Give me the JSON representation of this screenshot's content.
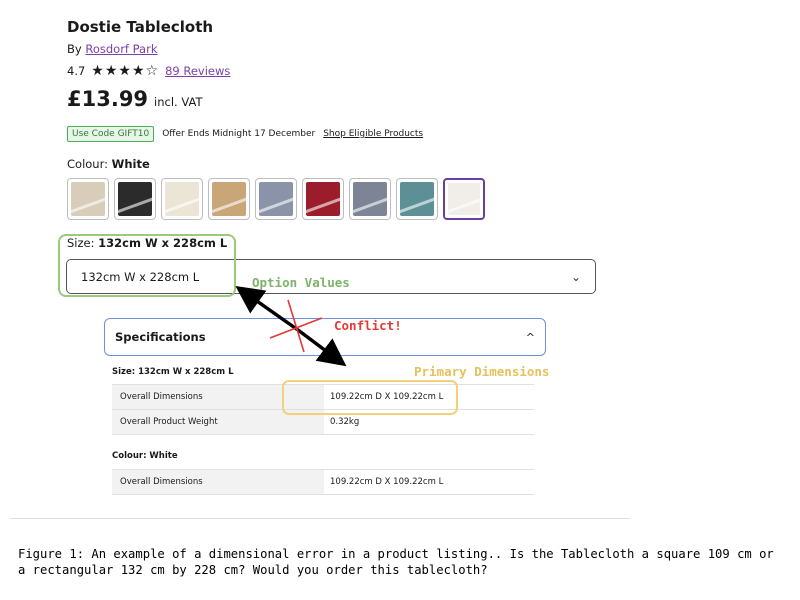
{
  "product": {
    "title": "Dostie Tablecloth",
    "by_prefix": "By",
    "brand": "Rosdorf Park",
    "rating": "4.7",
    "stars": "★★★★☆",
    "reviews": "89 Reviews",
    "price": "£13.99",
    "vat": "incl. VAT"
  },
  "promo": {
    "code": "Use Code GIFT10",
    "offer": "Offer Ends Midnight 17 December",
    "link": "Shop Eligible Products"
  },
  "colour": {
    "label": "Colour:",
    "value": "White",
    "swatches": [
      {
        "color": "#d8cdb8"
      },
      {
        "color": "#2b2b2b"
      },
      {
        "color": "#ebe5d5"
      },
      {
        "color": "#c9a678"
      },
      {
        "color": "#8a93a8"
      },
      {
        "color": "#9b1c2b"
      },
      {
        "color": "#7c8496"
      },
      {
        "color": "#5d8f97"
      },
      {
        "color": "#f1eeea"
      }
    ]
  },
  "size": {
    "label": "Size:",
    "value": "132cm W x 228cm L",
    "select_value": "132cm W x 228cm L"
  },
  "specs": {
    "title": "Specifications",
    "size_heading": "Size: 132cm W x 228cm L",
    "rows1": [
      {
        "k": "Overall Dimensions",
        "v": "109.22cm D X 109.22cm L"
      },
      {
        "k": "Overall Product Weight",
        "v": "0.32kg"
      }
    ],
    "colour_heading": "Colour: White",
    "rows2": [
      {
        "k": "Overall Dimensions",
        "v": "109.22cm D X 109.22cm L"
      }
    ]
  },
  "annotations": {
    "option_values": "Option Values",
    "primary_dimensions": "Primary Dimensions",
    "conflict": "Conflict!"
  },
  "caption": "Figure 1: An example of a dimensional error in a product listing.. Is the Tablecloth a square 109 cm or a rectangular 132 cm by 228 cm? Would you order this tablecloth?",
  "colors": {
    "accent": "#7b3fa8",
    "option_box": "#9bc97f",
    "primary_box": "#f1d17c",
    "conflict": "#e53935",
    "specs_border": "#6f8fe6"
  }
}
